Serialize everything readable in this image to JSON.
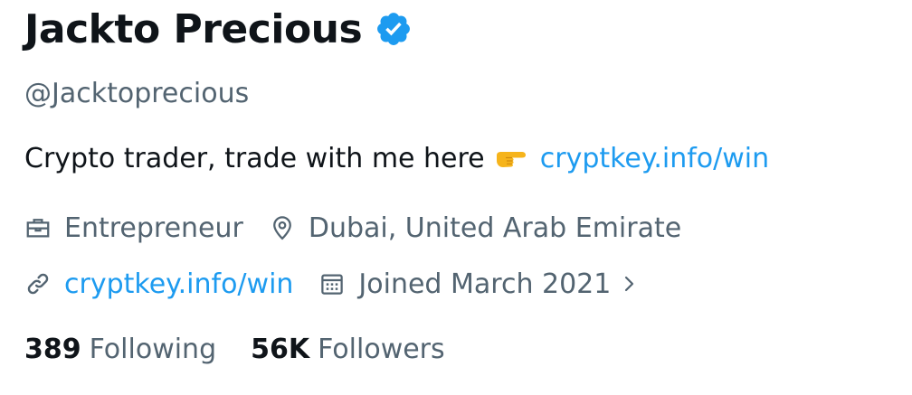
{
  "profile": {
    "display_name": "Jackto Precious",
    "verified_badge_icon": "verified-badge-icon",
    "handle": "@Jacktoprecious",
    "bio": {
      "text": "Crypto trader, trade with me here",
      "emoji_icon": "pointing-right-hand-emoji",
      "link": "cryptkey.info/win"
    },
    "meta": {
      "profession": "Entrepreneur",
      "location": "Dubai, United Arab Emirate",
      "website": "cryptkey.info/win",
      "joined": "Joined March 2021"
    },
    "stats": {
      "following_count": "389",
      "following_label": "Following",
      "followers_count": "56K",
      "followers_label": "Followers"
    }
  },
  "colors": {
    "text_primary": "#0f1419",
    "text_secondary": "#536471",
    "link": "#1d9bf0",
    "verified": "#1d9bf0",
    "emoji": "#f6b41b"
  }
}
